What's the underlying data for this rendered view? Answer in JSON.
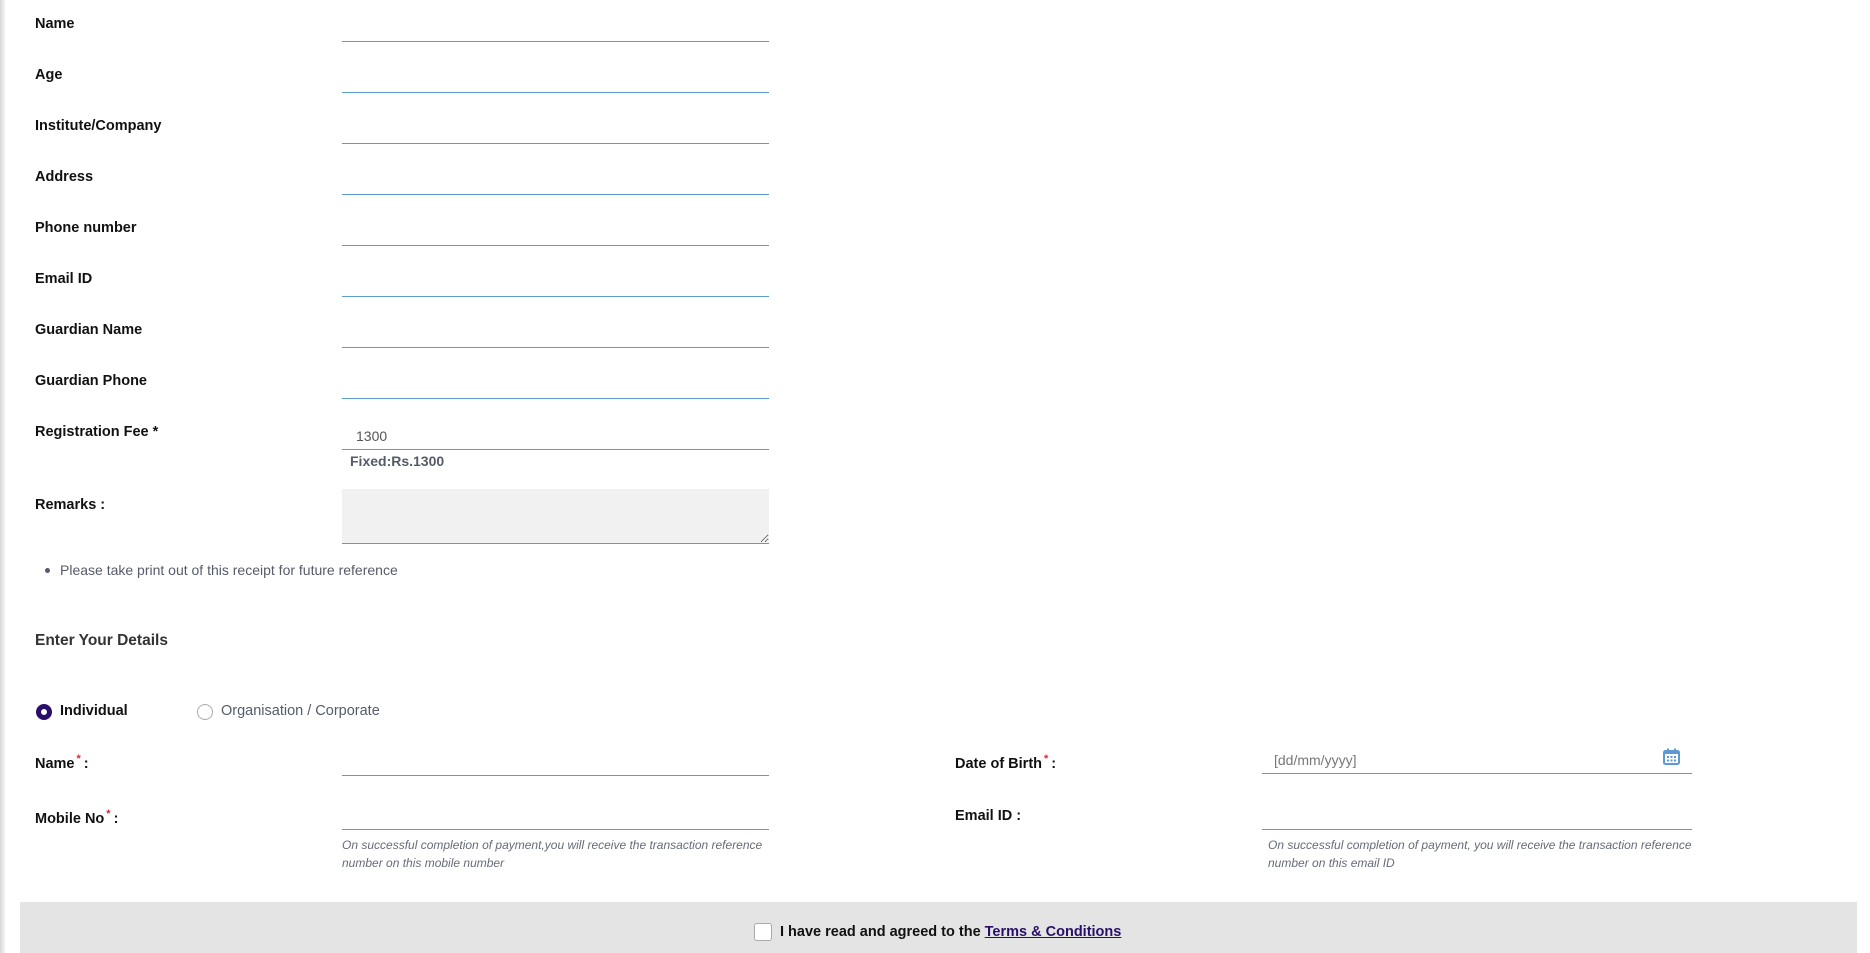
{
  "registration_fields": [
    {
      "label": "Name",
      "value": ""
    },
    {
      "label": "Age",
      "value": ""
    },
    {
      "label": "Institute/Company",
      "value": ""
    },
    {
      "label": "Address",
      "value": ""
    },
    {
      "label": "Phone number",
      "value": ""
    },
    {
      "label": "Email ID",
      "value": ""
    },
    {
      "label": "Guardian Name",
      "value": ""
    },
    {
      "label": "Guardian Phone",
      "value": ""
    },
    {
      "label": "Registration Fee *",
      "value": "1300"
    }
  ],
  "fee_note": "Fixed:Rs.1300",
  "remarks": {
    "label": "Remarks :",
    "value": ""
  },
  "notes": [
    "Please take print out of this receipt for future reference"
  ],
  "details": {
    "title": "Enter Your Details",
    "type_options": [
      {
        "label": "Individual",
        "selected": true
      },
      {
        "label": "Organisation / Corporate",
        "selected": false
      }
    ],
    "name_label": "Name",
    "mobile_label": "Mobile No",
    "dob_label": "Date of Birth",
    "email_label": "Email ID :",
    "colon": ":",
    "required_mark": "*",
    "dob_placeholder": "[dd/mm/yyyy]",
    "mobile_hint": "On successful completion of payment,you will receive the transaction reference number on this mobile number",
    "email_hint": "On successful completion of payment, you will receive the transaction reference number on this email ID"
  },
  "agreement": {
    "text": "I have read and agreed to the",
    "link": "Terms & Conditions",
    "checked": false
  },
  "colors": {
    "accent": "#5b9bd1",
    "brand": "#2a0f6a",
    "required": "#e0242f"
  }
}
